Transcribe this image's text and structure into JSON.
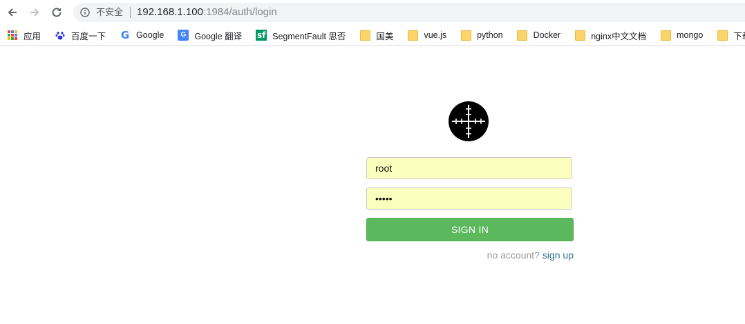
{
  "browser": {
    "insecure_label": "不安全",
    "url_host": "192.168.1.100",
    "url_path": ":1984/auth/login",
    "nav_icons": [
      "back-arrow-icon",
      "forward-arrow-icon",
      "reload-icon",
      "info-icon"
    ]
  },
  "bookmarks": [
    {
      "label": "应用",
      "icon": "apps-grid-icon"
    },
    {
      "label": "百度一下",
      "icon": "baidu-paw-icon"
    },
    {
      "label": "Google",
      "icon": "google-g-icon"
    },
    {
      "label": "Google 翻译",
      "icon": "google-translate-icon"
    },
    {
      "label": "SegmentFault 思否",
      "icon": "segmentfault-icon"
    },
    {
      "label": "国美",
      "icon": "folder-icon"
    },
    {
      "label": "vue.js",
      "icon": "folder-icon"
    },
    {
      "label": "python",
      "icon": "folder-icon"
    },
    {
      "label": "Docker",
      "icon": "folder-icon"
    },
    {
      "label": "nginx中文文档",
      "icon": "folder-icon"
    },
    {
      "label": "mongo",
      "icon": "folder-icon"
    },
    {
      "label": "下载软件",
      "icon": "folder-icon"
    }
  ],
  "login": {
    "logo": "crosshair-logo-icon",
    "username_value": "root",
    "password_value": "•••••",
    "signin_label": "SIGN IN",
    "no_account_text": "no account?",
    "signup_link": "sign up",
    "button_color": "#5cb85c",
    "autofill_color": "#faffbd"
  }
}
